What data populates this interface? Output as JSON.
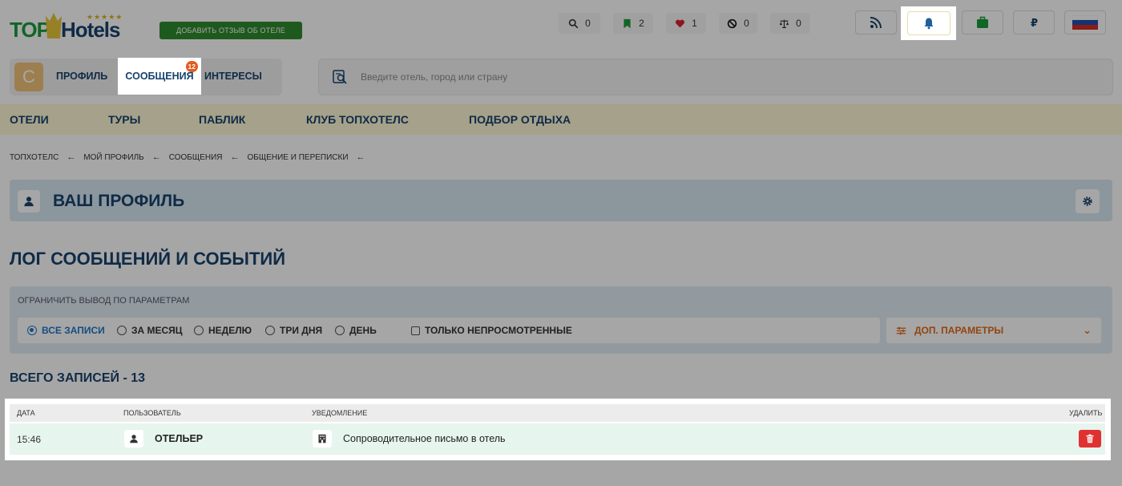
{
  "header": {
    "logo_top": "TOP",
    "logo_hotels": "Hotels",
    "logo_stars": "★★★★★",
    "review_button": "Добавить отзыв об отеле",
    "counters": [
      {
        "icon": "search-icon",
        "value": "0"
      },
      {
        "icon": "bookmark-icon",
        "value": "2",
        "color": "#1b9c3a"
      },
      {
        "icon": "heart-icon",
        "value": "1",
        "color": "#d9232e"
      },
      {
        "icon": "ban-icon",
        "value": "0"
      },
      {
        "icon": "scales-icon",
        "value": "0"
      }
    ],
    "buttons": [
      "rss-icon",
      "bell-icon",
      "suitcase-icon",
      "ruble-icon",
      "flag-russia-icon"
    ]
  },
  "user_tabs": {
    "avatar_letter": "C",
    "profile": "Профиль",
    "messages": "Сообщения",
    "messages_badge": "12",
    "interests": "Интересы"
  },
  "search": {
    "placeholder": "Введите отель, город или страну"
  },
  "nav": {
    "items": [
      "Отели",
      "Туры",
      "Паблик",
      "Клуб ТопХотелс",
      "Подбор отдыха"
    ]
  },
  "breadcrumbs": [
    "ТопХотелс",
    "Мой профиль",
    "Сообщения",
    "Общение и переписки"
  ],
  "profile": {
    "title": "Ваш профиль"
  },
  "log": {
    "title": "Лог сообщений и событий",
    "filter_label": "Ограничить вывод по параметрам",
    "radio_options": [
      "Все записи",
      "За месяц",
      "Неделю",
      "Три дня",
      "День"
    ],
    "selected_option": "Все записи",
    "checkbox_label": "Только непросмотренные",
    "extra_params": "Доп. параметры",
    "total": "Всего записей - 13"
  },
  "table": {
    "columns": [
      "Дата",
      "Пользователь",
      "Уведомление",
      "Удалить"
    ],
    "rows": [
      {
        "time": "15:46",
        "user": "Отельер",
        "notification": "Сопроводительное письмо в отель"
      }
    ]
  }
}
